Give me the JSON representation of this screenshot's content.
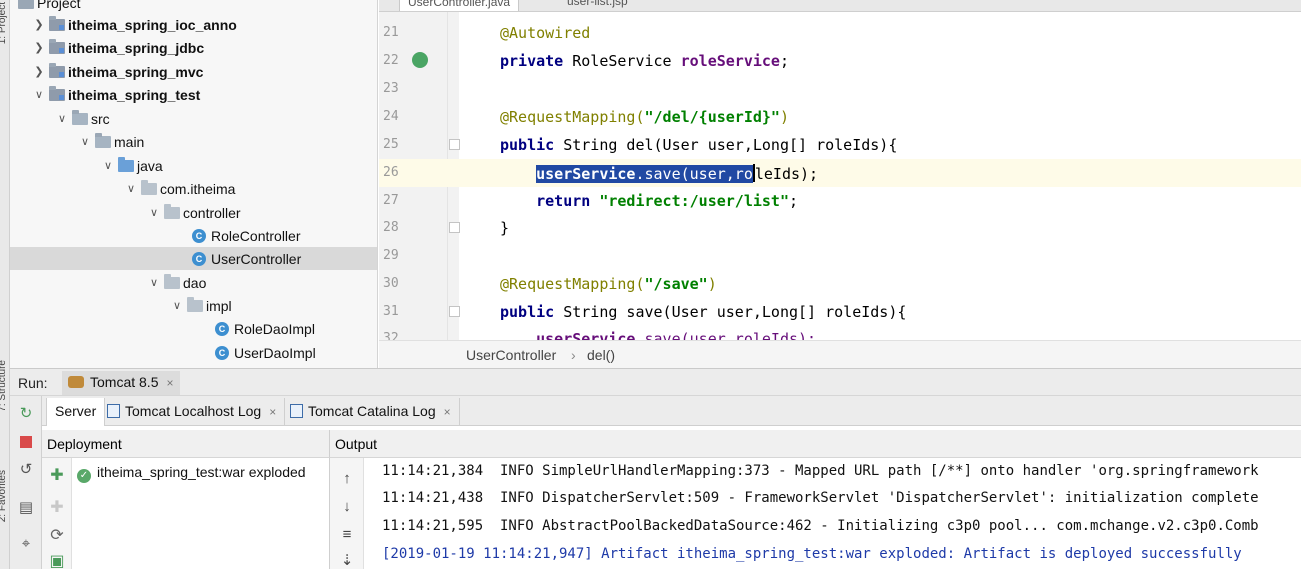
{
  "tool_strip": {
    "project_label": "1: Project",
    "structure_label": "7: Structure",
    "favorites_label": "2: Favorites"
  },
  "editor_tabs": [
    {
      "label": "UserController.java"
    },
    {
      "label": "user-list.jsp"
    }
  ],
  "project_panel": {
    "header_label": "Project",
    "tree": [
      {
        "label": "itheima_spring_ioc_anno",
        "bold": true,
        "expanded": false,
        "icon": "module-folder-icon"
      },
      {
        "label": "itheima_spring_jdbc",
        "bold": true,
        "expanded": false,
        "icon": "module-folder-icon"
      },
      {
        "label": "itheima_spring_mvc",
        "bold": true,
        "expanded": false,
        "icon": "module-folder-icon"
      },
      {
        "label": "itheima_spring_test",
        "bold": true,
        "expanded": true,
        "icon": "module-folder-icon"
      },
      {
        "label": "src",
        "expanded": true,
        "icon": "folder-icon"
      },
      {
        "label": "main",
        "expanded": true,
        "icon": "folder-icon"
      },
      {
        "label": "java",
        "expanded": true,
        "icon": "source-folder-icon"
      },
      {
        "label": "com.itheima",
        "expanded": true,
        "icon": "package-icon"
      },
      {
        "label": "controller",
        "expanded": true,
        "icon": "package-icon"
      },
      {
        "label": "RoleController",
        "icon": "class-icon"
      },
      {
        "label": "UserController",
        "icon": "class-icon",
        "selected": true
      },
      {
        "label": "dao",
        "expanded": true,
        "icon": "package-icon"
      },
      {
        "label": "impl",
        "expanded": true,
        "icon": "package-icon"
      },
      {
        "label": "RoleDaoImpl",
        "icon": "class-icon"
      },
      {
        "label": "UserDaoImpl",
        "icon": "class-icon"
      }
    ]
  },
  "editor": {
    "line_numbers": [
      "21",
      "22",
      "23",
      "24",
      "25",
      "26",
      "27",
      "28",
      "29",
      "30",
      "31",
      "32"
    ],
    "code": {
      "l21": "@Autowired",
      "l22_kw": "private",
      "l22_type": " RoleService ",
      "l22_field": "roleService",
      "l22_end": ";",
      "l24_ann": "@RequestMapping(",
      "l24_str": "\"/del/{userId}\"",
      "l24_end": ")",
      "l25_kw": "public",
      "l25_rest": " String del(User user,Long[] roleIds){",
      "l26_sel_field": "userService",
      "l26_sel_call": ".save(user,ro",
      "l26_rest": "leIds);",
      "l27_kw": "return ",
      "l27_str": "\"redirect:/user/list\"",
      "l27_end": ";",
      "l28": "}",
      "l30_ann": "@RequestMapping(",
      "l30_str": "\"/save\"",
      "l30_end": ")",
      "l31_kw": "public",
      "l31_rest": " String save(User user,Long[] roleIds){",
      "l32_field": "userService",
      "l32_call": ".save(user,roleIds);"
    },
    "breadcrumb": {
      "class": "UserController",
      "separator": "›",
      "method": "del()"
    }
  },
  "run_panel": {
    "run_label": "Run:",
    "config_tab": "Tomcat 8.5",
    "close_glyph": "×",
    "server_tabs": [
      {
        "label": "Server"
      },
      {
        "label": "Tomcat Localhost Log"
      },
      {
        "label": "Tomcat Catalina Log"
      }
    ],
    "deployment_header": "Deployment",
    "output_header": "Output",
    "artifact": "itheima_spring_test:war exploded",
    "log_lines": [
      "11:14:21,384  INFO SimpleUrlHandlerMapping:373 - Mapped URL path [/**] onto handler 'org.springframework",
      "11:14:21,438  INFO DispatcherServlet:509 - FrameworkServlet 'DispatcherServlet': initialization complete",
      "11:14:21,595  INFO AbstractPoolBackedDataSource:462 - Initializing c3p0 pool... com.mchange.v2.c3p0.Comb",
      "[2019-01-19 11:14:21,947] Artifact itheima_spring_test:war exploded: Artifact is deployed successfully"
    ]
  }
}
